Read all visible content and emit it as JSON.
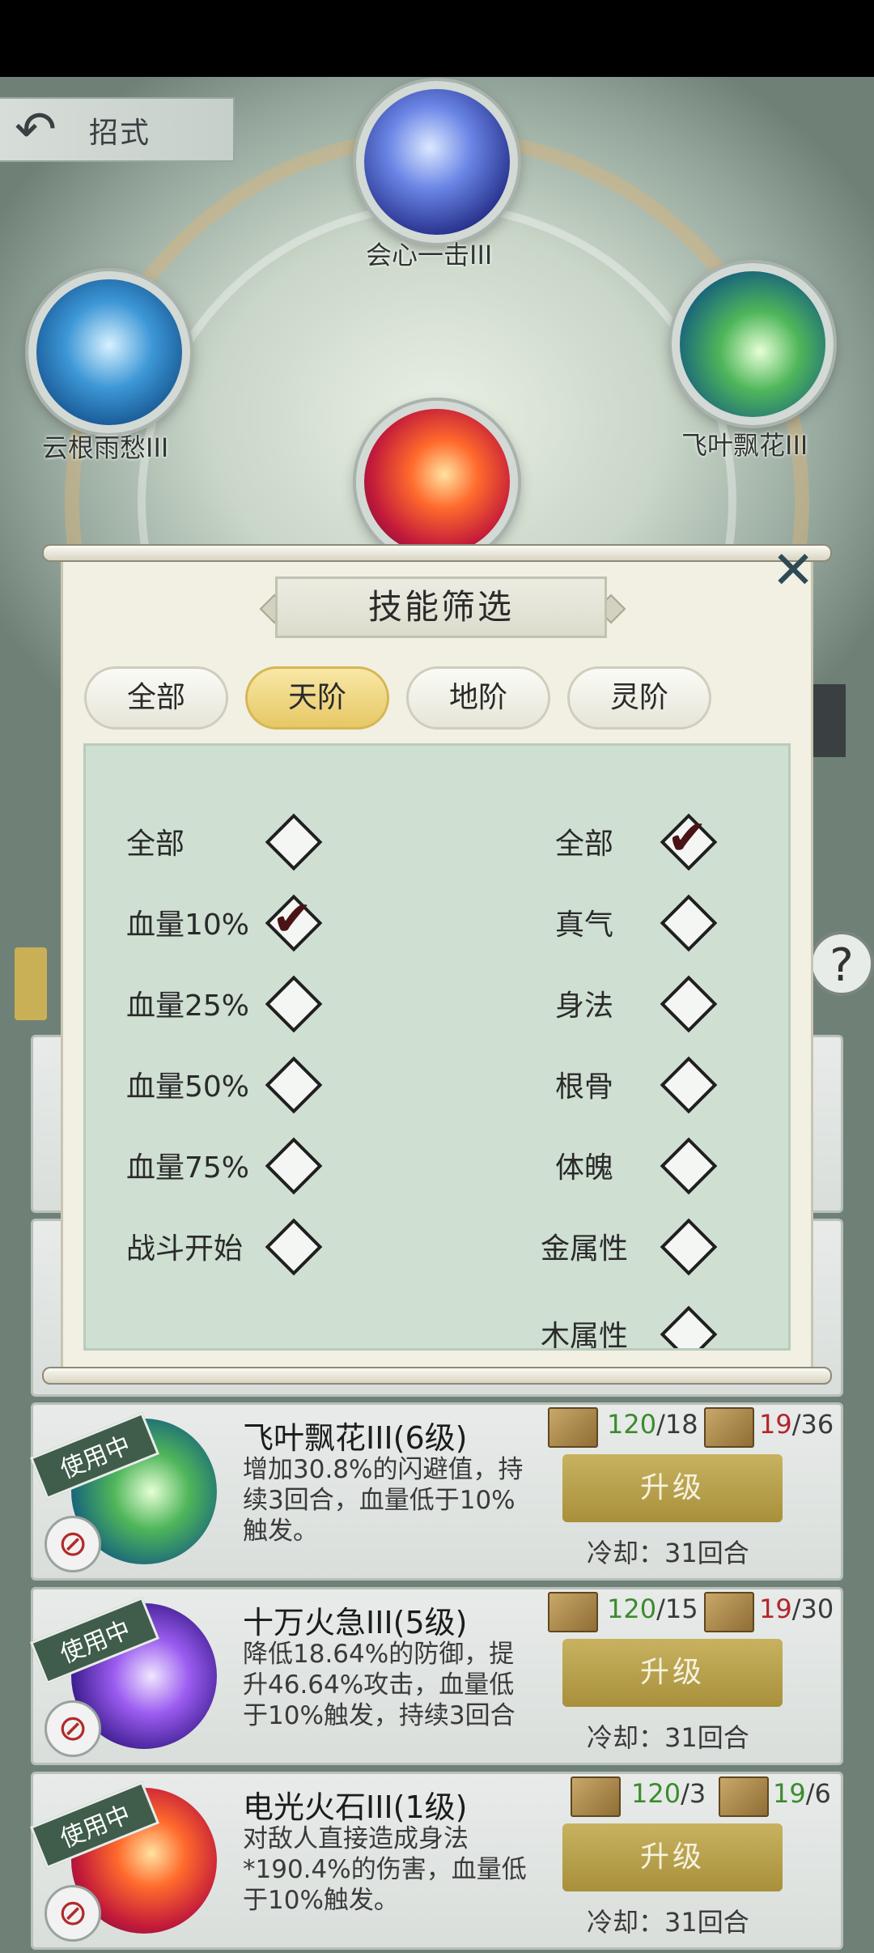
{
  "header": {
    "title": "招式",
    "back_icon": "back-arrow-icon"
  },
  "orbs": {
    "top": {
      "label": "会心一击III"
    },
    "left": {
      "label": "云根雨愁III"
    },
    "right": {
      "label": "飞叶飘花III"
    }
  },
  "modal": {
    "title": "技能筛选",
    "close_icon": "close-icon",
    "tabs": [
      {
        "label": "全部",
        "active": false
      },
      {
        "label": "天阶",
        "active": true
      },
      {
        "label": "地阶",
        "active": false
      },
      {
        "label": "灵阶",
        "active": false
      }
    ],
    "left_options": [
      {
        "label": "全部",
        "checked": false
      },
      {
        "label": "血量10%",
        "checked": true
      },
      {
        "label": "血量25%",
        "checked": false
      },
      {
        "label": "血量50%",
        "checked": false
      },
      {
        "label": "血量75%",
        "checked": false
      },
      {
        "label": "战斗开始",
        "checked": false
      }
    ],
    "right_options": [
      {
        "label": "全部",
        "checked": true
      },
      {
        "label": "真气",
        "checked": false
      },
      {
        "label": "身法",
        "checked": false
      },
      {
        "label": "根骨",
        "checked": false
      },
      {
        "label": "体魄",
        "checked": false
      },
      {
        "label": "金属性",
        "checked": false
      },
      {
        "label": "木属性",
        "checked": false
      }
    ]
  },
  "skills": [
    {
      "status": "使用中",
      "title": "飞叶飘花III(6级)",
      "desc": "增加30.8%的闪避值，持续3回合，血量低于10%触发。",
      "book1_have": "120",
      "book1_need": "/18",
      "book2_have": "19",
      "book2_need": "/36",
      "upgrade_label": "升级",
      "cooldown": "冷却：31回合"
    },
    {
      "status": "使用中",
      "title": "十万火急III(5级)",
      "desc": "降低18.64%的防御，提升46.64%攻击，血量低于10%触发，持续3回合",
      "book1_have": "120",
      "book1_need": "/15",
      "book2_have": "19",
      "book2_need": "/30",
      "upgrade_label": "升级",
      "cooldown": "冷却：31回合"
    },
    {
      "status": "使用中",
      "title": "电光火石III(1级)",
      "desc": "对敌人直接造成身法*190.4%的伤害，血量低于10%触发。",
      "book1_have": "120",
      "book1_need": "/3",
      "book2_have": "19",
      "book2_need": "/6",
      "upgrade_label": "升级",
      "cooldown": "冷却：31回合"
    }
  ],
  "help_icon": "help-icon"
}
